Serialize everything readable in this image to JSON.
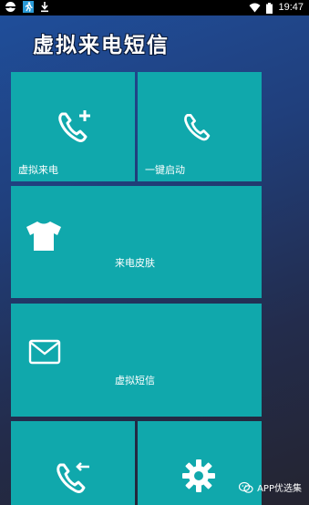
{
  "status_bar": {
    "time": "19:47",
    "icons": [
      "app-circle-icon",
      "running-man-icon",
      "download-icon",
      "wifi-icon",
      "battery-icon"
    ]
  },
  "app": {
    "title": "虚拟来电短信"
  },
  "tiles": {
    "fake_call": {
      "label": "虚拟来电",
      "icon": "phone-add-icon"
    },
    "one_key_start": {
      "label": "一键启动",
      "icon": "phone-icon"
    },
    "call_skin": {
      "label": "来电皮肤",
      "icon": "tshirt-icon"
    },
    "fake_sms": {
      "label": "虚拟短信",
      "icon": "envelope-icon"
    },
    "call_log": {
      "label": "",
      "icon": "phone-incoming-icon"
    },
    "settings": {
      "label": "",
      "icon": "gear-icon"
    }
  },
  "watermark": {
    "text": "APP优选集",
    "icon": "wechat-icon"
  },
  "colors": {
    "tile": "#10a8ac",
    "status_bar": "#000000",
    "text": "#ffffff"
  }
}
